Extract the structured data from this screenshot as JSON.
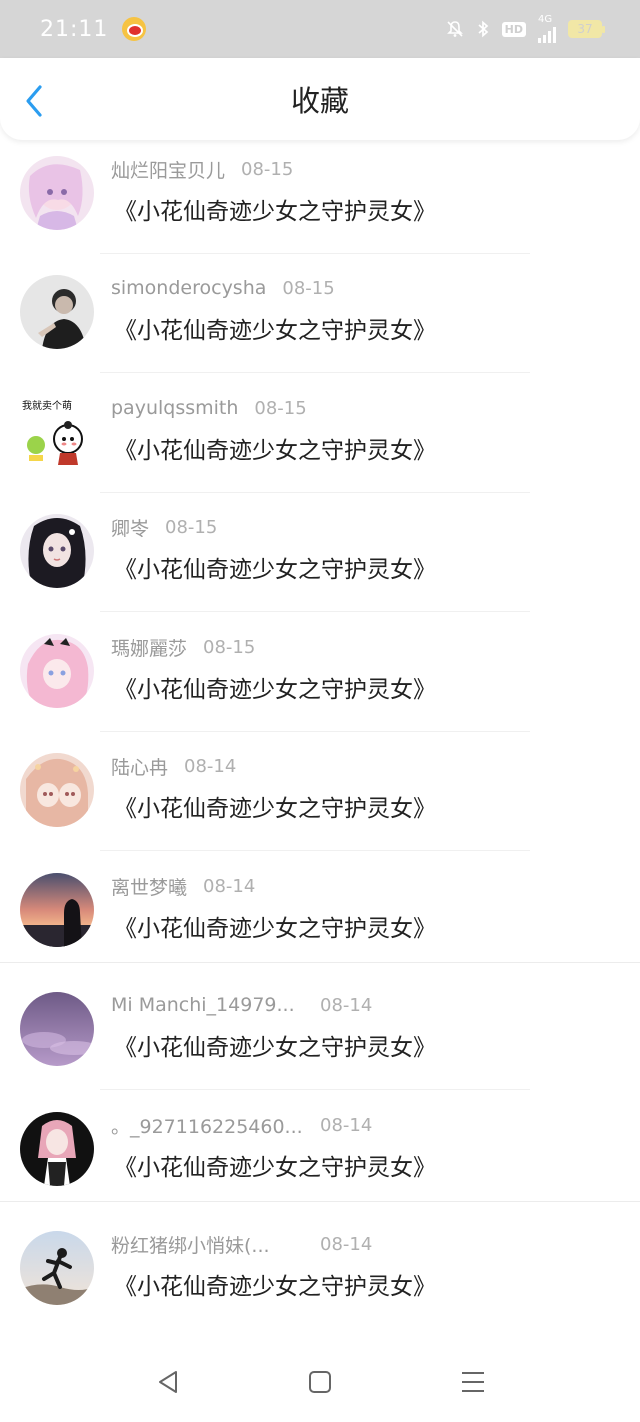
{
  "status_bar": {
    "time": "21:11",
    "hd": "HD",
    "net": "4G",
    "battery": "37"
  },
  "header": {
    "title": "收藏"
  },
  "items": [
    {
      "name": "灿烂阳宝贝儿",
      "date": "08-15",
      "content": "《小花仙奇迹少女之守护灵女》",
      "avatar": "avatar-pink-anime"
    },
    {
      "name": "simonderocysha",
      "date": "08-15",
      "content": "《小花仙奇迹少女之守护灵女》",
      "avatar": "avatar-bw-boy"
    },
    {
      "name": "payulqssmith",
      "date": "08-15",
      "content": "《小花仙奇迹少女之守护灵女》",
      "avatar": "avatar-meme-sticker",
      "avatar_text": "我就卖个萌"
    },
    {
      "name": "卿岺",
      "date": "08-15",
      "content": "《小花仙奇迹少女之守护灵女》",
      "avatar": "avatar-dark-hair-girl"
    },
    {
      "name": "瑪娜麗莎",
      "date": "08-15",
      "content": "《小花仙奇迹少女之守护灵女》",
      "avatar": "avatar-pink-anime-2"
    },
    {
      "name": "陆心冉",
      "date": "08-14",
      "content": "《小花仙奇迹少女之守护灵女》",
      "avatar": "avatar-peach-anime"
    },
    {
      "name": "离世梦曦",
      "date": "08-14",
      "content": "《小花仙奇迹少女之守护灵女》",
      "avatar": "avatar-sunset-silhouette"
    },
    {
      "name": "Mi Manchi_14979...",
      "date": "08-14",
      "content": "《小花仙奇迹少女之守护灵女》",
      "avatar": "avatar-purple-sky"
    },
    {
      "name": "。_927116225460...",
      "date": "08-14",
      "content": "《小花仙奇迹少女之守护灵女》",
      "avatar": "avatar-black-anime"
    },
    {
      "name": "粉红猪绑小悄妹(...",
      "date": "08-14",
      "content": "《小花仙奇迹少女之守护灵女》",
      "avatar": "avatar-runner-photo"
    }
  ]
}
